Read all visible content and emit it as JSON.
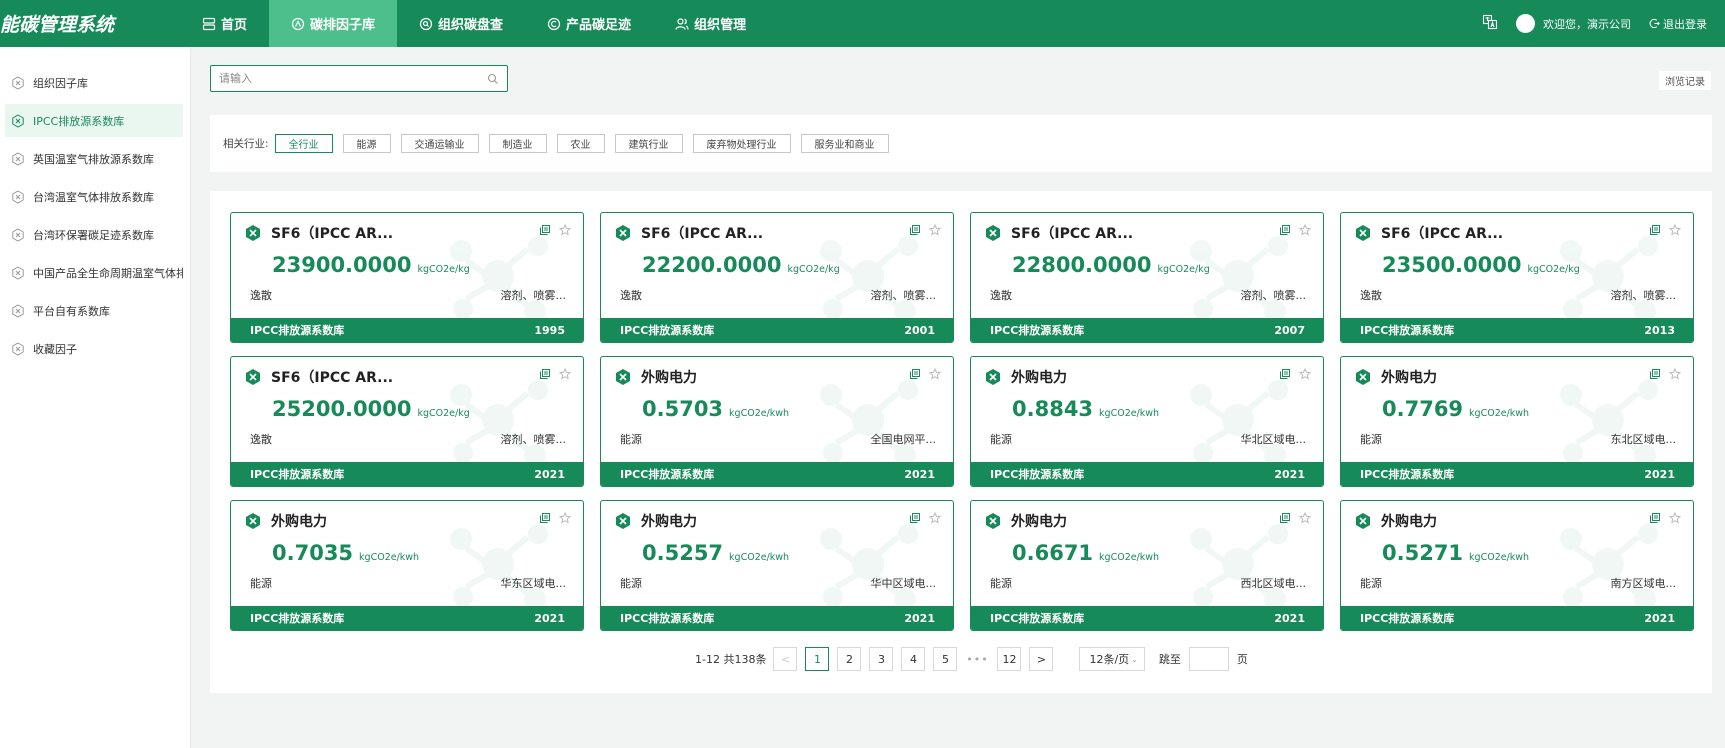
{
  "header": {
    "logo": "能碳管理系统",
    "nav": [
      {
        "label": "首页",
        "icon": "home-icon",
        "active": false
      },
      {
        "label": "碳排因子库",
        "icon": "factor-icon",
        "active": true
      },
      {
        "label": "组织碳盘查",
        "icon": "search-circle-icon",
        "active": false
      },
      {
        "label": "产品碳足迹",
        "icon": "copyright-icon",
        "active": false
      },
      {
        "label": "组织管理",
        "icon": "users-icon",
        "active": false
      }
    ],
    "welcome": "欢迎您，演示公司",
    "logout": "退出登录"
  },
  "sidebar": {
    "items": [
      {
        "label": "组织因子库",
        "active": false
      },
      {
        "label": "IPCC排放源系数库",
        "active": true
      },
      {
        "label": "英国温室气排放源系数库",
        "active": false
      },
      {
        "label": "台湾温室气体排放系数库",
        "active": false
      },
      {
        "label": "台湾环保署碳足迹系数库",
        "active": false
      },
      {
        "label": "中国产品全生命周期温室气体排",
        "active": false
      },
      {
        "label": "平台自有系数库",
        "active": false
      },
      {
        "label": "收藏因子",
        "active": false
      }
    ]
  },
  "search": {
    "placeholder": "请输入"
  },
  "browse_label": "浏览记录",
  "filter": {
    "label": "相关行业:",
    "tags": [
      "全行业",
      "能源",
      "交通运输业",
      "制造业",
      "农业",
      "建筑行业",
      "废弃物处理行业",
      "服务业和商业"
    ],
    "active_index": 0
  },
  "cards": [
    {
      "title": "SF6（IPCC AR...",
      "value": "23900.0000",
      "unit": "kgCO2e/kg",
      "category": "逸散",
      "desc": "溶剂、喷雾...",
      "source": "IPCC排放源系数库",
      "year": "1995"
    },
    {
      "title": "SF6（IPCC AR...",
      "value": "22200.0000",
      "unit": "kgCO2e/kg",
      "category": "逸散",
      "desc": "溶剂、喷雾...",
      "source": "IPCC排放源系数库",
      "year": "2001"
    },
    {
      "title": "SF6（IPCC AR...",
      "value": "22800.0000",
      "unit": "kgCO2e/kg",
      "category": "逸散",
      "desc": "溶剂、喷雾...",
      "source": "IPCC排放源系数库",
      "year": "2007"
    },
    {
      "title": "SF6（IPCC AR...",
      "value": "23500.0000",
      "unit": "kgCO2e/kg",
      "category": "逸散",
      "desc": "溶剂、喷雾...",
      "source": "IPCC排放源系数库",
      "year": "2013"
    },
    {
      "title": "SF6（IPCC AR...",
      "value": "25200.0000",
      "unit": "kgCO2e/kg",
      "category": "逸散",
      "desc": "溶剂、喷雾...",
      "source": "IPCC排放源系数库",
      "year": "2021"
    },
    {
      "title": "外购电力",
      "value": "0.5703",
      "unit": "kgCO2e/kwh",
      "category": "能源",
      "desc": "全国电网平...",
      "source": "IPCC排放源系数库",
      "year": "2021"
    },
    {
      "title": "外购电力",
      "value": "0.8843",
      "unit": "kgCO2e/kwh",
      "category": "能源",
      "desc": "华北区域电...",
      "source": "IPCC排放源系数库",
      "year": "2021"
    },
    {
      "title": "外购电力",
      "value": "0.7769",
      "unit": "kgCO2e/kwh",
      "category": "能源",
      "desc": "东北区域电...",
      "source": "IPCC排放源系数库",
      "year": "2021"
    },
    {
      "title": "外购电力",
      "value": "0.7035",
      "unit": "kgCO2e/kwh",
      "category": "能源",
      "desc": "华东区域电...",
      "source": "IPCC排放源系数库",
      "year": "2021"
    },
    {
      "title": "外购电力",
      "value": "0.5257",
      "unit": "kgCO2e/kwh",
      "category": "能源",
      "desc": "华中区域电...",
      "source": "IPCC排放源系数库",
      "year": "2021"
    },
    {
      "title": "外购电力",
      "value": "0.6671",
      "unit": "kgCO2e/kwh",
      "category": "能源",
      "desc": "西北区域电...",
      "source": "IPCC排放源系数库",
      "year": "2021"
    },
    {
      "title": "外购电力",
      "value": "0.5271",
      "unit": "kgCO2e/kwh",
      "category": "能源",
      "desc": "南方区域电...",
      "source": "IPCC排放源系数库",
      "year": "2021"
    }
  ],
  "pagination": {
    "total": "1-12 共138条",
    "prev": "<",
    "pages": [
      "1",
      "2",
      "3",
      "4",
      "5"
    ],
    "ellipsis": "•••",
    "last": "12",
    "next": ">",
    "current": "1",
    "page_size": "12条/页",
    "jump_label": "跳至",
    "page_suffix": "页"
  },
  "colors": {
    "primary": "#178a5a",
    "nav_active": "#4cbf8c"
  }
}
